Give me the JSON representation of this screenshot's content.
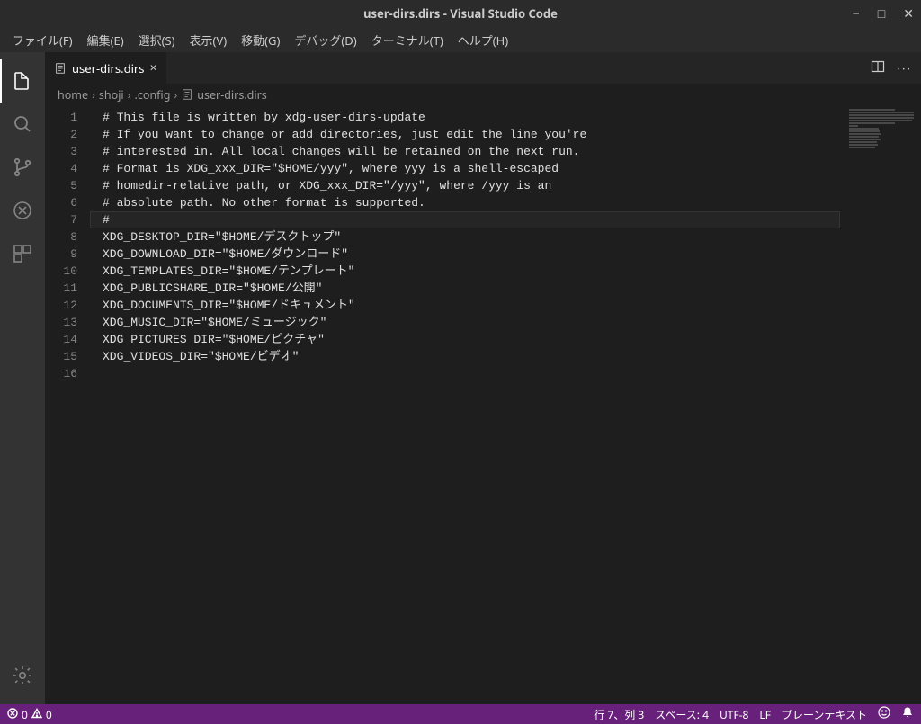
{
  "titlebar": {
    "title": "user-dirs.dirs - Visual Studio Code"
  },
  "menubar": {
    "items": [
      "ファイル(F)",
      "編集(E)",
      "選択(S)",
      "表示(V)",
      "移動(G)",
      "デバッグ(D)",
      "ターミナル(T)",
      "ヘルプ(H)"
    ]
  },
  "tab": {
    "label": "user-dirs.dirs"
  },
  "breadcrumb": {
    "segments": [
      "home",
      "shoji",
      ".config",
      "user-dirs.dirs"
    ]
  },
  "editor": {
    "current_line": 7,
    "lines": [
      "# This file is written by xdg-user-dirs-update",
      "# If you want to change or add directories, just edit the line you're",
      "# interested in. All local changes will be retained on the next run.",
      "# Format is XDG_xxx_DIR=\"$HOME/yyy\", where yyy is a shell-escaped",
      "# homedir-relative path, or XDG_xxx_DIR=\"/yyy\", where /yyy is an",
      "# absolute path. No other format is supported.",
      "# ",
      "XDG_DESKTOP_DIR=\"$HOME/デスクトップ\"",
      "XDG_DOWNLOAD_DIR=\"$HOME/ダウンロード\"",
      "XDG_TEMPLATES_DIR=\"$HOME/テンプレート\"",
      "XDG_PUBLICSHARE_DIR=\"$HOME/公開\"",
      "XDG_DOCUMENTS_DIR=\"$HOME/ドキュメント\"",
      "XDG_MUSIC_DIR=\"$HOME/ミュージック\"",
      "XDG_PICTURES_DIR=\"$HOME/ピクチャ\"",
      "XDG_VIDEOS_DIR=\"$HOME/ビデオ\"",
      ""
    ]
  },
  "statusbar": {
    "errors": "0",
    "warnings": "0",
    "cursor": "行 7、列 3",
    "spaces": "スペース: 4",
    "encoding": "UTF-8",
    "eol": "LF",
    "lang": "プレーンテキスト"
  }
}
